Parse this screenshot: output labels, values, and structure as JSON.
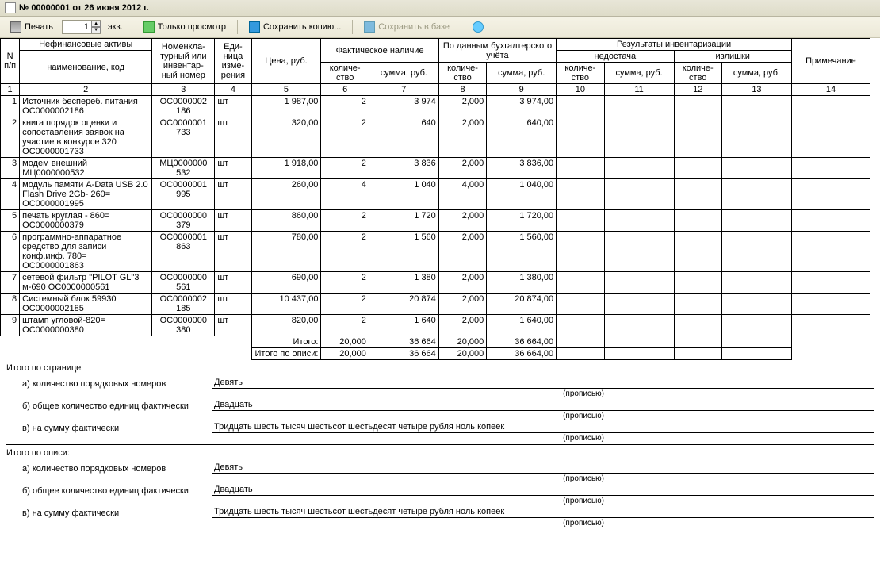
{
  "window": {
    "title": "№ 00000001 от 26 июня 2012 г."
  },
  "toolbar": {
    "print": "Печать",
    "copies": "1",
    "ekz": "экз.",
    "view_only": "Только просмотр",
    "save_copy": "Сохранить копию...",
    "save_base": "Сохранить в базе"
  },
  "headers": {
    "npp": "N п/п",
    "nonfin": "Нефинансовые активы",
    "name_code": "наименование, код",
    "nomen": "Номенкла-\nтурный или инвентар-\nный номер",
    "unit": "Еди-\nница изме-\nрения",
    "price": "Цена, руб.",
    "fact": "Фактическое наличие",
    "acct": "По данным бухгалтерского учёта",
    "results": "Результаты инвентаризации",
    "shortage": "недостача",
    "surplus": "излишки",
    "note": "Примечание",
    "qty": "количе-\nство",
    "sum": "сумма, руб."
  },
  "colnums": [
    "1",
    "2",
    "3",
    "4",
    "5",
    "6",
    "7",
    "8",
    "9",
    "10",
    "11",
    "12",
    "13",
    "14"
  ],
  "rows": [
    {
      "n": "1",
      "name": "Источник беспереб. питания ОС0000002186",
      "nomen": "ОС0000002186",
      "unit": "шт",
      "price": "1 987,00",
      "fq": "2",
      "fs": "3 974",
      "aq": "2,000",
      "as": "3 974,00"
    },
    {
      "n": "2",
      "name": "книга порядок оценки и сопоставления заявок на участие в конкурсе 320 ОС0000001733",
      "nomen": "ОС0000001733",
      "unit": "шт",
      "price": "320,00",
      "fq": "2",
      "fs": "640",
      "aq": "2,000",
      "as": "640,00"
    },
    {
      "n": "3",
      "name": "модем внешний МЦ0000000532",
      "nomen": "МЦ0000000532",
      "unit": "шт",
      "price": "1 918,00",
      "fq": "2",
      "fs": "3 836",
      "aq": "2,000",
      "as": "3 836,00"
    },
    {
      "n": "4",
      "name": "модуль памяти A-Data USB 2.0 Flash Drive 2Gb- 260= ОС0000001995",
      "nomen": "ОС0000001995",
      "unit": "шт",
      "price": "260,00",
      "fq": "4",
      "fs": "1 040",
      "aq": "4,000",
      "as": "1 040,00"
    },
    {
      "n": "5",
      "name": "печать круглая - 860= ОС0000000379",
      "nomen": "ОС0000000379",
      "unit": "шт",
      "price": "860,00",
      "fq": "2",
      "fs": "1 720",
      "aq": "2,000",
      "as": "1 720,00"
    },
    {
      "n": "6",
      "name": "программно-аппаратное средство для записи конф.инф. 780= ОС0000001863",
      "nomen": "ОС0000001863",
      "unit": "шт",
      "price": "780,00",
      "fq": "2",
      "fs": "1 560",
      "aq": "2,000",
      "as": "1 560,00"
    },
    {
      "n": "7",
      "name": "сетевой фильтр \"PILOT GL\"3 м-690 ОС0000000561",
      "nomen": "ОС0000000561",
      "unit": "шт",
      "price": "690,00",
      "fq": "2",
      "fs": "1 380",
      "aq": "2,000",
      "as": "1 380,00"
    },
    {
      "n": "8",
      "name": "Системный блок 59930 ОС0000002185",
      "nomen": "ОС0000002185",
      "unit": "шт",
      "price": "10 437,00",
      "fq": "2",
      "fs": "20 874",
      "aq": "2,000",
      "as": "20 874,00"
    },
    {
      "n": "9",
      "name": "штамп угловой-820= ОС0000000380",
      "nomen": "ОС0000000380",
      "unit": "шт",
      "price": "820,00",
      "fq": "2",
      "fs": "1 640",
      "aq": "2,000",
      "as": "1 640,00"
    }
  ],
  "totals": {
    "itogo_label": "Итого:",
    "itogo_opis_label": "Итого по описи:",
    "fq": "20,000",
    "fs": "36 664",
    "aq": "20,000",
    "as": "36 664,00"
  },
  "summary": {
    "page_title": "Итого по странице",
    "opis_title": "Итого по описи:",
    "a_label": "а) количество порядковых номеров",
    "b_label": "б) общее  количество единиц фактически",
    "v_label": "в) на сумму фактически",
    "a_val": "Девять",
    "b_val": "Двадцать",
    "v_val": "Тридцать шесть тысяч шестьсот шестьдесят четыре рубля ноль копеек",
    "propis": "(прописью)"
  }
}
